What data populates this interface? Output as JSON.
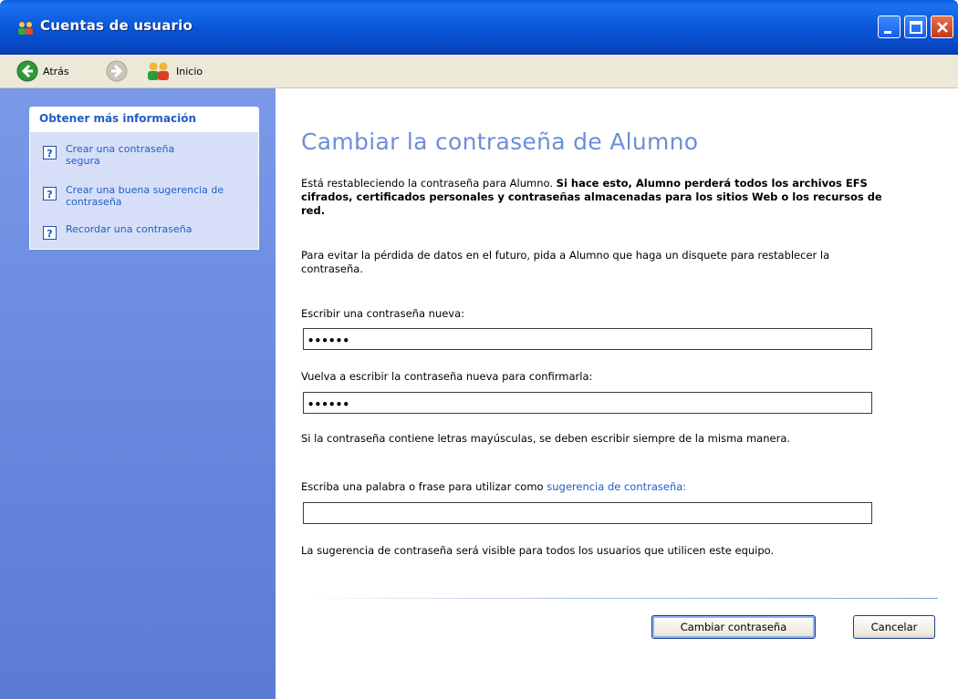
{
  "window": {
    "title": "Cuentas de usuario"
  },
  "toolbar": {
    "back_label": "Atrás",
    "home_label": "Inicio"
  },
  "sidebar": {
    "heading": "Obtener más información",
    "links": [
      {
        "label": "Crear una contraseña segura"
      },
      {
        "label": "Crear una buena sugerencia de contraseña"
      },
      {
        "label": "Recordar una contraseña"
      }
    ]
  },
  "main": {
    "title": "Cambiar la contraseña de Alumno",
    "intro_normal": "Está restableciendo la contraseña para Alumno. ",
    "intro_bold": "Si hace esto, Alumno perderá todos los archivos EFS cifrados, certificados personales y contraseñas almacenadas para los sitios Web o los recursos de red.",
    "advice": "Para evitar la pérdida de datos en el futuro, pida a Alumno que haga un disquete para restablecer la contraseña.",
    "new_password_label": "Escribir una contraseña nueva:",
    "new_password_value": "••••••",
    "confirm_password_label": "Vuelva a escribir la contraseña nueva para confirmarla:",
    "confirm_password_value": "••••••",
    "case_note": "Si la contraseña contiene letras mayúsculas, se deben escribir siempre de la misma manera.",
    "hint_label_prefix": "Escriba una palabra o frase para utilizar como ",
    "hint_link": "sugerencia de contraseña:",
    "hint_value": "",
    "hint_note": "La sugerencia de contraseña será visible para todos los usuarios que utilicen este equipo.",
    "change_button": "Cambiar contraseña",
    "cancel_button": "Cancelar"
  },
  "icons": {
    "app": "user-accounts-icon",
    "back": "back-arrow-icon",
    "forward": "forward-arrow-icon",
    "home": "users-home-icon",
    "help": "help-question-icon"
  },
  "colors": {
    "titlebar": "#0a55d8",
    "sidebar": "#6b8ce0",
    "link": "#215dc6",
    "title_text": "#6c8ed9"
  }
}
